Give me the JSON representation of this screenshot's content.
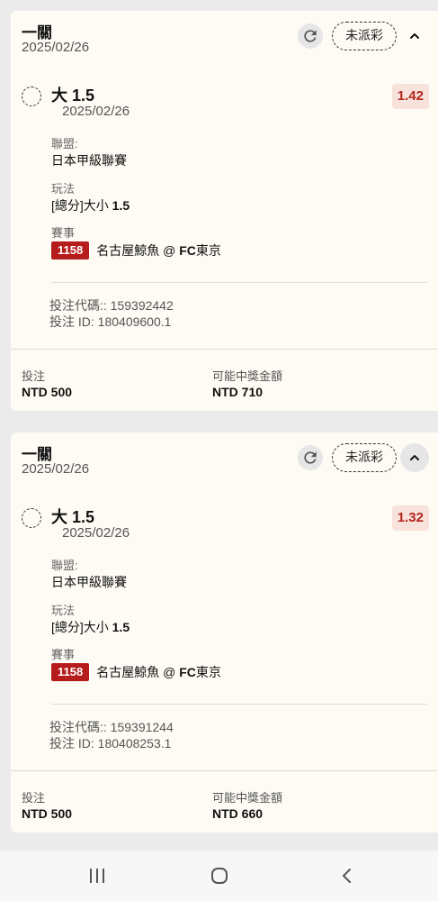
{
  "bets": [
    {
      "title": "一關",
      "date": "2025/02/26",
      "status": "未派彩",
      "collapse_filled": false,
      "selection": {
        "name": "大 1.5",
        "date": "2025/02/26",
        "odds": "1.42"
      },
      "league_label": "聯盟:",
      "league": "日本甲級聯賽",
      "market_label": "玩法",
      "market_prefix": "[總分]大小 ",
      "market_line": "1.5",
      "event_label": "賽事",
      "event_id": "1158",
      "event_home": "名古屋鯨魚 @ ",
      "event_away_bold": "FC",
      "event_away": "東京",
      "code_line": "投注代碼:: 159392442",
      "id_line": "投注 ID: 180409600.1",
      "stake_label": "投注",
      "stake": "NTD 500",
      "payout_label": "可能中獎金額",
      "payout": "NTD 710"
    },
    {
      "title": "一關",
      "date": "2025/02/26",
      "status": "未派彩",
      "collapse_filled": true,
      "selection": {
        "name": "大 1.5",
        "date": "2025/02/26",
        "odds": "1.32"
      },
      "league_label": "聯盟:",
      "league": "日本甲級聯賽",
      "market_label": "玩法",
      "market_prefix": "[總分]大小 ",
      "market_line": "1.5",
      "event_label": "賽事",
      "event_id": "1158",
      "event_home": "名古屋鯨魚 @ ",
      "event_away_bold": "FC",
      "event_away": "東京",
      "code_line": "投注代碼:: 159391244",
      "id_line": "投注 ID: 180408253.1",
      "stake_label": "投注",
      "stake": "NTD 500",
      "payout_label": "可能中獎金額",
      "payout": "NTD 660"
    }
  ],
  "navbar": {
    "recents_icon": "recents-icon",
    "home_icon": "home-icon",
    "back_icon": "back-icon"
  }
}
